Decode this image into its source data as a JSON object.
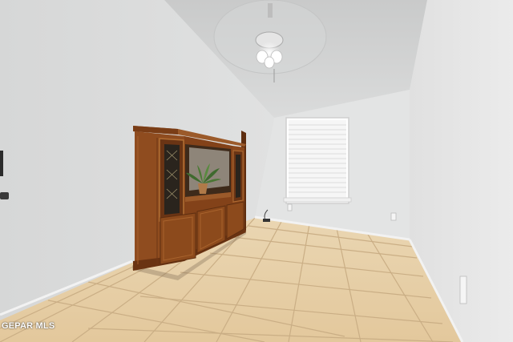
{
  "photo": {
    "subject": "empty-room-interior",
    "watermark": "GEPAR MLS"
  },
  "colors": {
    "wall_left": "#dcdddd",
    "wall_back": "#e2e3e3",
    "wall_right": "#e6e6e6",
    "ceiling": "#cfd0d0",
    "floor_tile": "#e6cfa8",
    "grout": "#c9ad83",
    "cabinet": "#8a4a1f",
    "cabinet_dark": "#5e2e10",
    "blind": "#f4f4f4"
  }
}
